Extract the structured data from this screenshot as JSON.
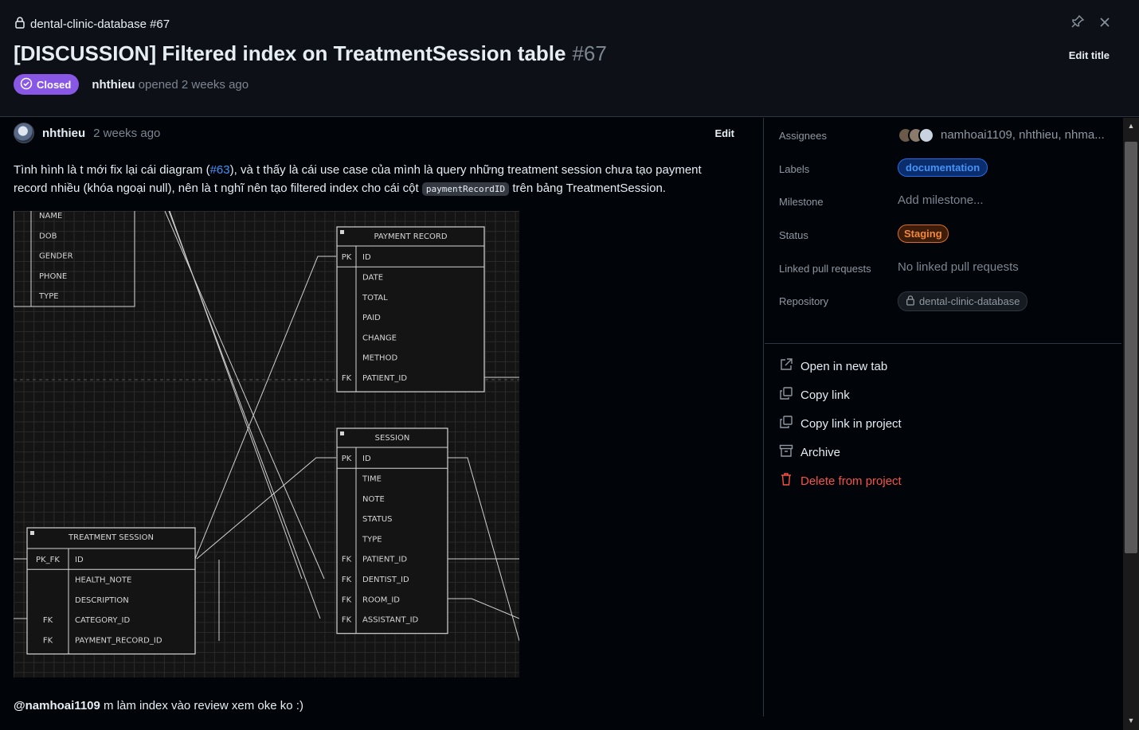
{
  "header": {
    "repo_ref": "dental-clinic-database #67",
    "title": "[DISCUSSION] Filtered index on TreatmentSession table",
    "number": "#67",
    "state": "Closed",
    "author": "nhthieu",
    "opened_text": "opened 2 weeks ago",
    "edit_title": "Edit title"
  },
  "comment": {
    "author": "nhthieu",
    "time": "2 weeks ago",
    "edit": "Edit",
    "text_1": "Tình hình là t mới fix lại cái diagram (",
    "link": "#63",
    "text_2": "), và t thấy là cái use case của mình là query những treatment session chưa tạo payment record nhiều (khóa ngoại null), nên là t nghĩ nên tạo filtered index cho cái cột ",
    "code": "paymentRecordID",
    "text_3": " trên bảng TreatmentSession.",
    "mention": "@namhoai1109",
    "mention_text": " m làm index vào review xem oke ko :)"
  },
  "diagram": {
    "top_table_fields": [
      "NAME",
      "DOB",
      "GENDER",
      "PHONE",
      "TYPE"
    ],
    "payment": {
      "title": "PAYMENT RECORD",
      "rows": [
        {
          "key": "PK",
          "name": "ID"
        },
        {
          "key": "",
          "name": "DATE"
        },
        {
          "key": "",
          "name": "TOTAL"
        },
        {
          "key": "",
          "name": "PAID"
        },
        {
          "key": "",
          "name": "CHANGE"
        },
        {
          "key": "",
          "name": "METHOD"
        },
        {
          "key": "FK",
          "name": "PATIENT_ID"
        }
      ]
    },
    "session": {
      "title": "SESSION",
      "rows": [
        {
          "key": "PK",
          "name": "ID"
        },
        {
          "key": "",
          "name": "TIME"
        },
        {
          "key": "",
          "name": "NOTE"
        },
        {
          "key": "",
          "name": "STATUS"
        },
        {
          "key": "",
          "name": "TYPE"
        },
        {
          "key": "FK",
          "name": "PATIENT_ID"
        },
        {
          "key": "FK",
          "name": "DENTIST_ID"
        },
        {
          "key": "FK",
          "name": "ROOM_ID"
        },
        {
          "key": "FK",
          "name": "ASSISTANT_ID"
        }
      ]
    },
    "treatment": {
      "title": "TREATMENT SESSION",
      "rows": [
        {
          "key": "PK_FK",
          "name": "ID"
        },
        {
          "key": "",
          "name": "HEALTH_NOTE"
        },
        {
          "key": "",
          "name": "DESCRIPTION"
        },
        {
          "key": "FK",
          "name": "CATEGORY_ID"
        },
        {
          "key": "FK",
          "name": "PAYMENT_RECORD_ID"
        }
      ]
    }
  },
  "sidebar": {
    "assignees_label": "Assignees",
    "assignees_value": "namhoai1109, nhthieu, nhma...",
    "labels_label": "Labels",
    "label_tag": "documentation",
    "milestone_label": "Milestone",
    "milestone_value": "Add milestone...",
    "status_label": "Status",
    "status_value": "Staging",
    "linked_label": "Linked pull requests",
    "linked_value": "No linked pull requests",
    "repository_label": "Repository",
    "repository_value": "dental-clinic-database",
    "actions": {
      "open_new_tab": "Open in new tab",
      "copy_link": "Copy link",
      "copy_link_project": "Copy link in project",
      "archive": "Archive",
      "delete": "Delete from project"
    }
  },
  "colors": {
    "closed": "#8957e5",
    "link": "#4493f8",
    "danger": "#f85149",
    "staging": "#f0883e"
  },
  "icons": [
    "lock-icon",
    "pin-icon",
    "close-icon",
    "closed-check-icon",
    "external-link-icon",
    "copy-icon",
    "archive-icon",
    "trash-icon"
  ]
}
